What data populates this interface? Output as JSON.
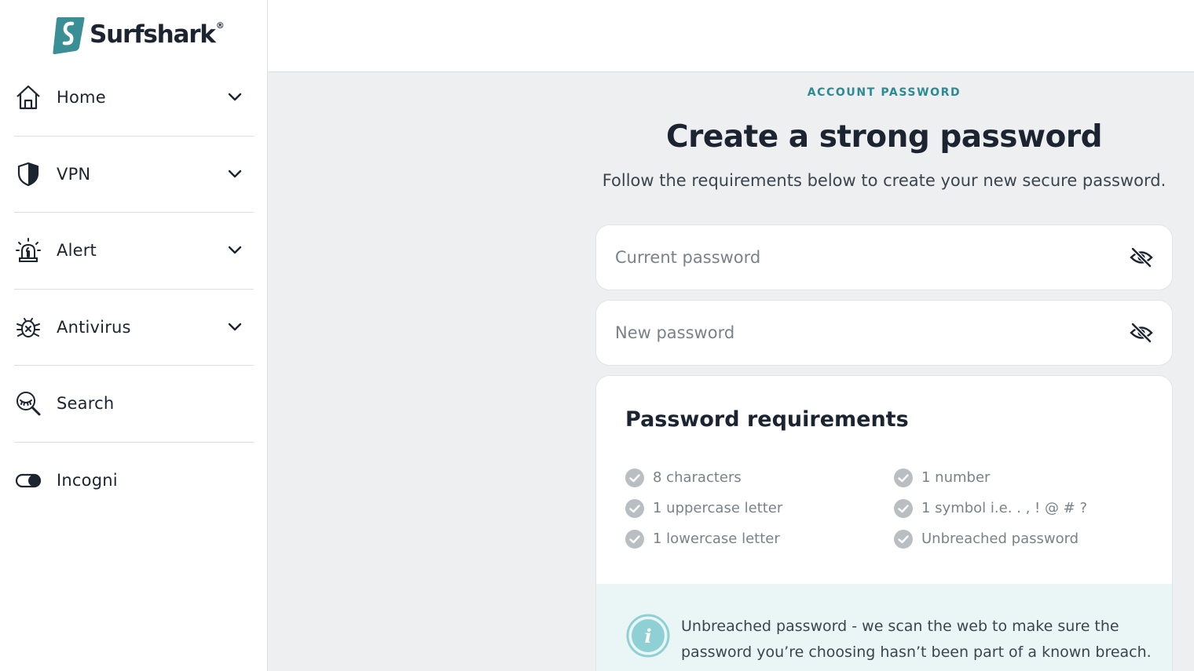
{
  "brand": {
    "name": "Surfshark",
    "registered": "®",
    "accent": "#3a8f96"
  },
  "sidebar": {
    "items": [
      {
        "label": "Home",
        "icon": "home-icon",
        "expandable": true
      },
      {
        "label": "VPN",
        "icon": "shield-icon",
        "expandable": true
      },
      {
        "label": "Alert",
        "icon": "siren-icon",
        "expandable": true
      },
      {
        "label": "Antivirus",
        "icon": "bug-icon",
        "expandable": true
      },
      {
        "label": "Search",
        "icon": "search-eye-icon",
        "expandable": false
      },
      {
        "label": "Incogni",
        "icon": "toggle-icon",
        "expandable": false
      }
    ]
  },
  "main": {
    "eyebrow": "ACCOUNT PASSWORD",
    "title": "Create a strong password",
    "subtitle": "Follow the requirements below to create your new secure password.",
    "current_password": {
      "placeholder": "Current password",
      "value": ""
    },
    "new_password": {
      "placeholder": "New password",
      "value": ""
    },
    "requirements": {
      "title": "Password requirements",
      "left": [
        "8 characters",
        "1 uppercase letter",
        "1 lowercase letter"
      ],
      "right": [
        "1 number",
        "1 symbol i.e. . , ! @ # ?",
        "Unbreached password"
      ]
    },
    "info": {
      "text": "Unbreached password - we scan the web to make sure the password you’re choosing hasn’t been part of a known breach."
    }
  }
}
